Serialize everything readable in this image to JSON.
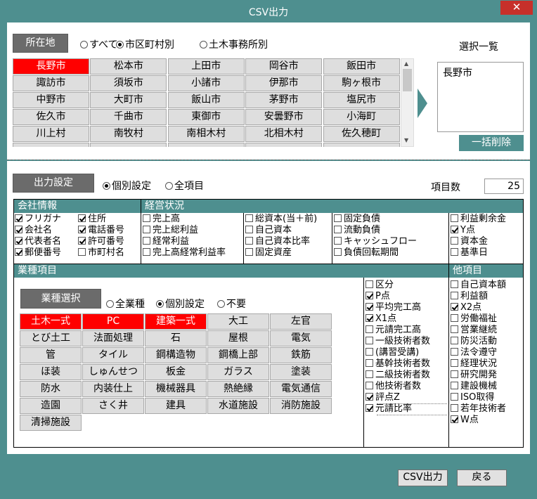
{
  "window": {
    "title": "CSV出力",
    "close_glyph": "✕"
  },
  "location": {
    "button": "所在地",
    "radios": [
      {
        "label": "すべて",
        "checked": false
      },
      {
        "label": "市区町村別",
        "checked": true
      },
      {
        "label": "土木事務所別",
        "checked": false
      }
    ],
    "grid": [
      [
        "長野市",
        "松本市",
        "上田市",
        "岡谷市",
        "飯田市"
      ],
      [
        "諏訪市",
        "須坂市",
        "小諸市",
        "伊那市",
        "駒ヶ根市"
      ],
      [
        "中野市",
        "大町市",
        "飯山市",
        "茅野市",
        "塩尻市"
      ],
      [
        "佐久市",
        "千曲市",
        "東御市",
        "安曇野市",
        "小海町"
      ],
      [
        "川上村",
        "南牧村",
        "南相木村",
        "北相木村",
        "佐久穂町"
      ]
    ],
    "selected": [
      "長野市"
    ],
    "selection_title": "選択一覧",
    "selection_items": [
      "長野市"
    ],
    "clear_button": "一括削除"
  },
  "output": {
    "button": "出力設定",
    "radios": [
      {
        "label": "個別設定",
        "checked": true
      },
      {
        "label": "全項目",
        "checked": false
      }
    ],
    "count_label": "項目数",
    "count_value": "25"
  },
  "company": {
    "header": "会社情報",
    "col1": [
      {
        "label": "フリガナ",
        "checked": true
      },
      {
        "label": "会社名",
        "checked": true
      },
      {
        "label": "代表者名",
        "checked": true
      },
      {
        "label": "郵便番号",
        "checked": true
      }
    ],
    "col2": [
      {
        "label": "住所",
        "checked": true
      },
      {
        "label": "電話番号",
        "checked": true
      },
      {
        "label": "許可番号",
        "checked": true
      },
      {
        "label": "市町村名",
        "checked": false
      }
    ]
  },
  "management": {
    "header": "経営状況",
    "col1": [
      {
        "label": "完上高",
        "checked": false
      },
      {
        "label": "完上総利益",
        "checked": false
      },
      {
        "label": "経常利益",
        "checked": false
      },
      {
        "label": "完上高経常利益率",
        "checked": false
      }
    ],
    "col2": [
      {
        "label": "総資本(当＋前)",
        "checked": false
      },
      {
        "label": "自己資本",
        "checked": false
      },
      {
        "label": "自己資本比率",
        "checked": false
      },
      {
        "label": "固定資産",
        "checked": false
      }
    ],
    "col3": [
      {
        "label": "固定負債",
        "checked": false
      },
      {
        "label": "流動負債",
        "checked": false
      },
      {
        "label": "キャッシュフロー",
        "checked": false
      },
      {
        "label": "負債回転期間",
        "checked": false
      }
    ],
    "col4": [
      {
        "label": "利益剰余金",
        "checked": false
      },
      {
        "label": "Y点",
        "checked": true
      },
      {
        "label": "資本金",
        "checked": false
      },
      {
        "label": "基準日",
        "checked": false
      }
    ]
  },
  "industry": {
    "header": "業種項目",
    "button": "業種選択",
    "radios": [
      {
        "label": "全業種",
        "checked": false
      },
      {
        "label": "個別設定",
        "checked": true
      },
      {
        "label": "不要",
        "checked": false
      }
    ],
    "grid": [
      [
        "土木一式",
        "PC",
        "建築一式",
        "大工",
        "左官"
      ],
      [
        "とび土工",
        "法面処理",
        "石",
        "屋根",
        "電気"
      ],
      [
        "管",
        "タイル",
        "鋼構造物",
        "鋼橋上部",
        "鉄筋"
      ],
      [
        "ほ装",
        "しゅんせつ",
        "板金",
        "ガラス",
        "塗装"
      ],
      [
        "防水",
        "内装仕上",
        "機械器具",
        "熱絶縁",
        "電気通信"
      ],
      [
        "造園",
        "さく井",
        "建具",
        "水道施設",
        "消防施設"
      ],
      [
        "清掃施設"
      ]
    ],
    "selected": [
      "土木一式",
      "PC",
      "建築一式"
    ],
    "items": [
      {
        "label": "区分",
        "checked": false
      },
      {
        "label": "P点",
        "checked": true
      },
      {
        "label": "平均完工高",
        "checked": true
      },
      {
        "label": "X1点",
        "checked": true
      },
      {
        "label": "元請完工高",
        "checked": false
      },
      {
        "label": "一級技術者数",
        "checked": false
      },
      {
        "label": "(講習受講)",
        "checked": false
      },
      {
        "label": "基幹技術者数",
        "checked": false
      },
      {
        "label": "二級技術者数",
        "checked": false
      },
      {
        "label": "他技術者数",
        "checked": false
      },
      {
        "label": "評点Z",
        "checked": true
      },
      {
        "label": "元請比率",
        "checked": true
      }
    ]
  },
  "other": {
    "header": "他項目",
    "items": [
      {
        "label": "自己資本額",
        "checked": false
      },
      {
        "label": "利益額",
        "checked": false
      },
      {
        "label": "X2点",
        "checked": true
      },
      {
        "label": "労働福祉",
        "checked": false
      },
      {
        "label": "営業継続",
        "checked": false
      },
      {
        "label": "防災活動",
        "checked": false
      },
      {
        "label": "法令遵守",
        "checked": false
      },
      {
        "label": "経理状況",
        "checked": false
      },
      {
        "label": "研究開発",
        "checked": false
      },
      {
        "label": "建設機械",
        "checked": false
      },
      {
        "label": "ISO取得",
        "checked": false
      },
      {
        "label": "若年技術者",
        "checked": false
      },
      {
        "label": "W点",
        "checked": true
      }
    ]
  },
  "footer": {
    "csv_button": "CSV出力",
    "back_button": "戻る"
  },
  "colors": {
    "accent": "#4e8f8f",
    "selected": "#ff0000",
    "close": "#c7302a"
  }
}
